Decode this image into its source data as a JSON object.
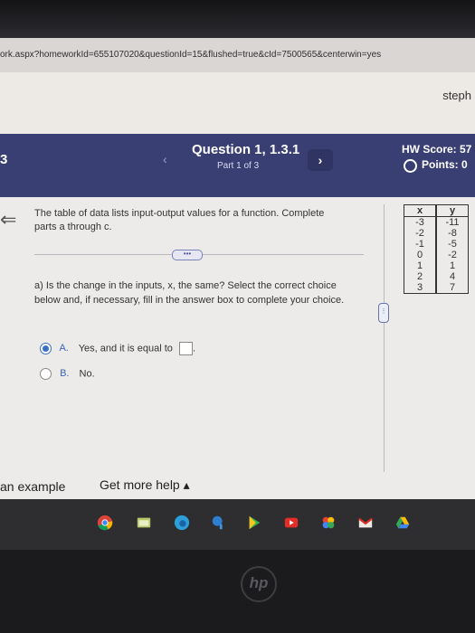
{
  "browser": {
    "url": "ork.aspx?homeworkId=655107020&questionId=15&flushed=true&cId=7500565&centerwin=yes"
  },
  "page": {
    "user_name": "steph"
  },
  "header": {
    "left_number": "3",
    "question_title": "Question 1, 1.3.1",
    "part_label": "Part 1 of 3",
    "hw_score": "HW Score: 57",
    "points": "Points: 0"
  },
  "question": {
    "intro": "The table of data lists input-output values for a function. Complete parts a through c.",
    "more_label": "•••",
    "part_a": "a) Is the change in the inputs, x, the same? Select the correct choice below and, if necessary, fill in the answer box to complete your choice.",
    "choices": [
      {
        "letter": "A.",
        "text": "Yes, and it is equal to",
        "selected": true
      },
      {
        "letter": "B.",
        "text": "No.",
        "selected": false
      }
    ]
  },
  "data_table": {
    "headers": [
      "x",
      "y"
    ],
    "rows": [
      [
        "-3",
        "-11"
      ],
      [
        "-2",
        "-8"
      ],
      [
        "-1",
        "-5"
      ],
      [
        "0",
        "-2"
      ],
      [
        "1",
        "1"
      ],
      [
        "2",
        "4"
      ],
      [
        "3",
        "7"
      ]
    ]
  },
  "footer": {
    "example_label": "an example",
    "help_label": "Get more help ▴"
  },
  "dock": {
    "icons": [
      "chrome-icon",
      "file-explorer-icon",
      "edge-icon",
      "paint-icon",
      "play-store-icon",
      "youtube-icon",
      "photos-icon",
      "gmail-icon",
      "drive-icon"
    ]
  },
  "brand": {
    "logo_text": "hp"
  },
  "colors": {
    "header": "#3a3f73",
    "accent": "#3b6fc7",
    "content_bg": "#ecebe9"
  }
}
